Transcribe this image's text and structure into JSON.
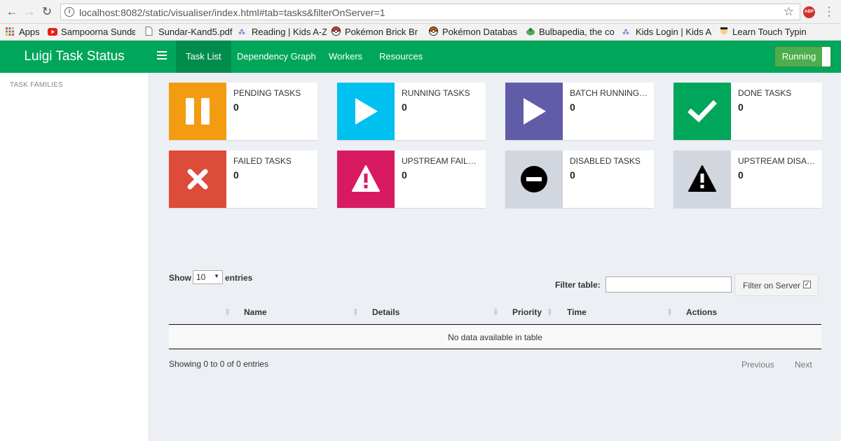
{
  "browser": {
    "url": "localhost:8082/static/visualiser/index.html#tab=tasks&filterOnServer=1",
    "bookmarks": [
      {
        "label": "Apps",
        "icon": "apps-grid-icon"
      },
      {
        "label": "Sampoorna Sundε",
        "icon": "youtube-icon"
      },
      {
        "label": "Sundar-Kand5.pdf",
        "icon": "document-icon"
      },
      {
        "label": "Reading | Kids A-Z",
        "icon": "kids-az-icon"
      },
      {
        "label": "Pokémon Brick Br",
        "icon": "pokeball-icon"
      },
      {
        "label": "Pokémon Databas",
        "icon": "pokeball-icon"
      },
      {
        "label": "Bulbapedia, the co",
        "icon": "bulbasaur-icon"
      },
      {
        "label": "Kids Login | Kids A",
        "icon": "kids-az-icon"
      },
      {
        "label": "Learn Touch Typin",
        "icon": "typing-icon"
      }
    ]
  },
  "app": {
    "title": "Luigi Task Status",
    "tabs": [
      {
        "label": "Task List",
        "active": true
      },
      {
        "label": "Dependency Graph"
      },
      {
        "label": "Workers"
      },
      {
        "label": "Resources"
      }
    ],
    "status_button": "Running"
  },
  "sidebar": {
    "heading": "TASK FAMILIES"
  },
  "info_boxes": [
    {
      "label": "PENDING TASKS",
      "count": "0",
      "color": "#f39c12",
      "icon": "pause-icon"
    },
    {
      "label": "RUNNING TASKS",
      "count": "0",
      "color": "#00c0ef",
      "icon": "play-icon"
    },
    {
      "label": "BATCH RUNNING TASKS",
      "count": "0",
      "color": "#605ca8",
      "icon": "play-icon"
    },
    {
      "label": "DONE TASKS",
      "count": "0",
      "color": "#00a65a",
      "icon": "check-icon"
    },
    {
      "label": "FAILED TASKS",
      "count": "0",
      "color": "#dd4b39",
      "icon": "times-icon"
    },
    {
      "label": "UPSTREAM FAILURE",
      "count": "0",
      "color": "#d81b60",
      "icon": "warning-icon"
    },
    {
      "label": "DISABLED TASKS",
      "count": "0",
      "color": "#d2d6de",
      "icon": "minus-circle-icon"
    },
    {
      "label": "UPSTREAM DISABLED",
      "count": "0",
      "color": "#d2d6de",
      "icon": "warning-icon"
    }
  ],
  "table": {
    "show_label": "Show",
    "page_length": "10",
    "entries_label": "entries",
    "filter_label": "Filter table:",
    "filter_value": "",
    "server_filter_label": "Filter on Server",
    "server_filter_checked": true,
    "columns": [
      "Name",
      "Details",
      "Priority",
      "Time",
      "Actions"
    ],
    "empty_message": "No data available in table",
    "info": "Showing 0 to 0 of 0 entries",
    "previous": "Previous",
    "next": "Next"
  }
}
